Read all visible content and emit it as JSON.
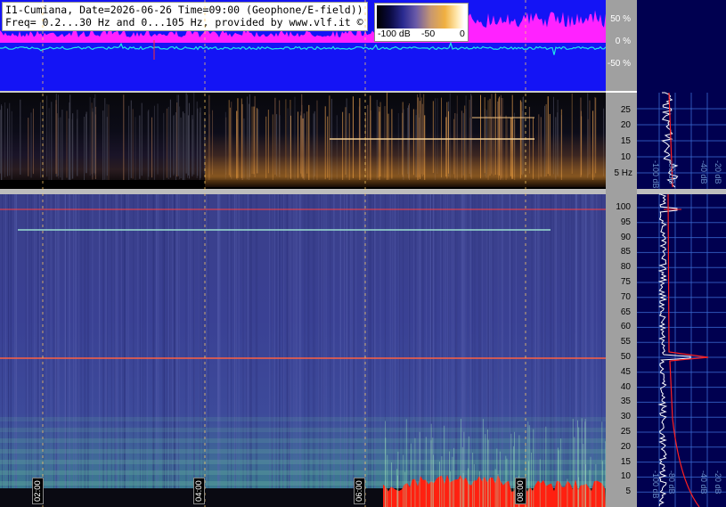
{
  "header": {
    "line1": "I1-Cumiana, Date=2026-06-26 Time=09:00 (Geophone/E-field))",
    "line2": "Freq= 0.2...30 Hz and 0...105 Hz, provided by www.vlf.it ©"
  },
  "colorbar": {
    "labels": [
      "-100 dB",
      "-50",
      "0"
    ]
  },
  "waveform_axis": {
    "labels": [
      "50 %",
      "0 %",
      "-50 %"
    ]
  },
  "low_spec_axis": {
    "ticks": [
      "25",
      "20",
      "15",
      "10",
      "5 Hz"
    ]
  },
  "high_spec_axis": {
    "ticks": [
      "100",
      "95",
      "90",
      "85",
      "80",
      "75",
      "70",
      "65",
      "60",
      "55",
      "50",
      "45",
      "40",
      "35",
      "30",
      "25",
      "20",
      "15",
      "10",
      "5"
    ]
  },
  "profile_labels": {
    "low": [
      "-100 dB",
      "-80 dB",
      "-40 dB",
      "-20 dB"
    ],
    "high": [
      "-100 dB",
      "-80 dB",
      "-40 dB",
      "-20 dB"
    ]
  },
  "time_labels": [
    "02:00",
    "04:00",
    "06:00",
    "08:00"
  ],
  "colors": {
    "waveform_bg": "#1414f5",
    "magenta": "#ff22ff",
    "cyan": "#20e8e8",
    "profile_bg": "#000050",
    "axis_bg": "#a0a0a0"
  }
}
